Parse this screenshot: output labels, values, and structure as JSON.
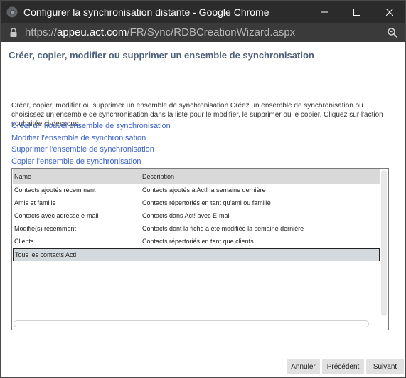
{
  "window": {
    "title": "Configurer la synchronisation distante - Google Chrome",
    "controls": {
      "minimize": "minimize-icon",
      "maximize": "maximize-icon",
      "close": "close-icon"
    }
  },
  "addressbar": {
    "url_prefix": "https://",
    "url_host": "appeu.act.com",
    "url_path": "/FR/Sync/RDBCreationWizard.aspx"
  },
  "page": {
    "heading": "Créer, copier, modifier ou supprimer un ensemble de synchronisation",
    "intro": "Créer, copier, modifier ou supprimer un ensemble de synchronisation Créez un ensemble de synchronisation ou choisissez un ensemble de synchronisation dans la liste pour le modifier, le supprimer ou le copier. Cliquez sur l'action souhaitée ci-dessous.",
    "links": [
      "Créer un nouvel ensemble de synchronisation",
      "Modifier l'ensemble de synchronisation",
      "Supprimer l'ensemble de synchronisation",
      "Copier l'ensemble de synchronisation"
    ]
  },
  "table": {
    "columns": [
      "Name",
      "Description"
    ],
    "rows": [
      {
        "name": "Contacts ajoutés récemment",
        "description": "Contacts ajoutés à Act! la semaine dernière"
      },
      {
        "name": "Amis et famille",
        "description": "Contacts répertoriés en tant qu'ami ou famille"
      },
      {
        "name": "Contacts avec adresse e-mail",
        "description": "Contacts dans Act! avec E-mail"
      },
      {
        "name": "Modifié(s) récemment",
        "description": "Contacts dont la fiche a été modifiée la semaine dernière"
      },
      {
        "name": "Clients",
        "description": "Contacts répertoriés en tant que clients"
      }
    ],
    "selected_row": {
      "name": "Tous les contacts Act!",
      "description": ""
    }
  },
  "footer": {
    "cancel": "Annuler",
    "previous": "Précédent",
    "next": "Suivant"
  },
  "colors": {
    "titlebar": "#2b2b2b",
    "heading": "#4f6178",
    "link": "#3b64c9",
    "selected_row": "#d4d9dd"
  }
}
